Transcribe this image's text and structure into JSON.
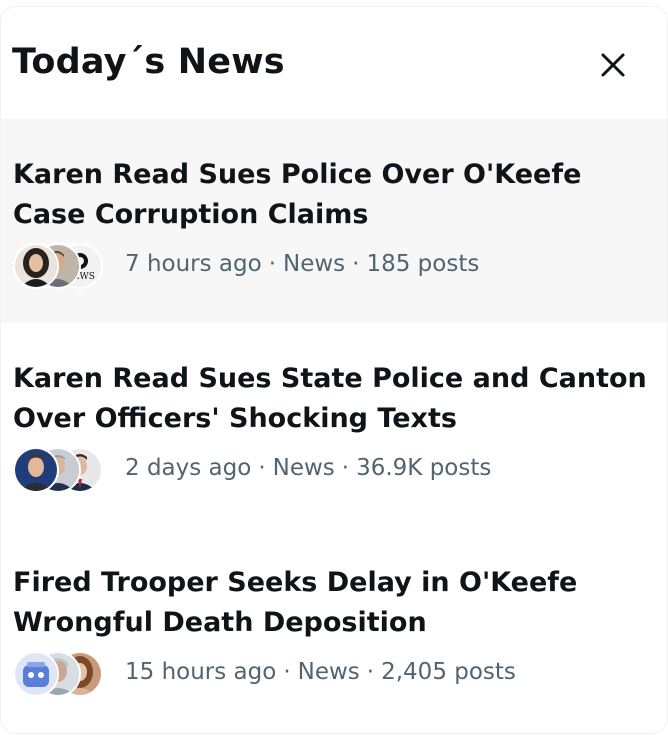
{
  "header": {
    "title": "Today´s News"
  },
  "news": [
    {
      "headline": "Karen Read Sues Police Over O'Keefe Case Corruption Claims",
      "time": "7 hours ago",
      "category": "News",
      "posts": "185 posts",
      "avatar_icons": [
        "woman-avatar-icon",
        "man-avatar-icon",
        "news-logo-icon"
      ]
    },
    {
      "headline": "Karen Read Sues State Police and Canton Over Officers' Shocking Texts",
      "time": "2 days ago",
      "category": "News",
      "posts": "36.9K posts",
      "avatar_icons": [
        "man-avatar-icon",
        "man-avatar-icon",
        "man-avatar-icon"
      ]
    },
    {
      "headline": "Fired Trooper Seeks Delay in O'Keefe Wrongful Death Deposition",
      "time": "15 hours ago",
      "category": "News",
      "posts": "2,405 posts",
      "avatar_icons": [
        "cartoon-avatar-icon",
        "person-avatar-icon",
        "woman-avatar-icon"
      ]
    }
  ],
  "separator": "·",
  "news_logo_text": "NEWS",
  "colors": {
    "text_primary": "#0f1419",
    "text_secondary": "#536471",
    "highlight_bg": "#f7f7f7"
  }
}
